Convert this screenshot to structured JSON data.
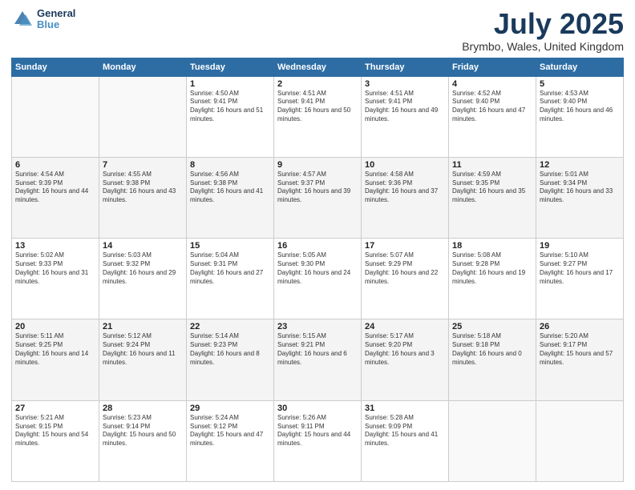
{
  "header": {
    "logo_line1": "General",
    "logo_line2": "Blue",
    "month_title": "July 2025",
    "location": "Brymbo, Wales, United Kingdom"
  },
  "days_of_week": [
    "Sunday",
    "Monday",
    "Tuesday",
    "Wednesday",
    "Thursday",
    "Friday",
    "Saturday"
  ],
  "weeks": [
    [
      {
        "day": "",
        "info": ""
      },
      {
        "day": "",
        "info": ""
      },
      {
        "day": "1",
        "info": "Sunrise: 4:50 AM\nSunset: 9:41 PM\nDaylight: 16 hours and 51 minutes."
      },
      {
        "day": "2",
        "info": "Sunrise: 4:51 AM\nSunset: 9:41 PM\nDaylight: 16 hours and 50 minutes."
      },
      {
        "day": "3",
        "info": "Sunrise: 4:51 AM\nSunset: 9:41 PM\nDaylight: 16 hours and 49 minutes."
      },
      {
        "day": "4",
        "info": "Sunrise: 4:52 AM\nSunset: 9:40 PM\nDaylight: 16 hours and 47 minutes."
      },
      {
        "day": "5",
        "info": "Sunrise: 4:53 AM\nSunset: 9:40 PM\nDaylight: 16 hours and 46 minutes."
      }
    ],
    [
      {
        "day": "6",
        "info": "Sunrise: 4:54 AM\nSunset: 9:39 PM\nDaylight: 16 hours and 44 minutes."
      },
      {
        "day": "7",
        "info": "Sunrise: 4:55 AM\nSunset: 9:38 PM\nDaylight: 16 hours and 43 minutes."
      },
      {
        "day": "8",
        "info": "Sunrise: 4:56 AM\nSunset: 9:38 PM\nDaylight: 16 hours and 41 minutes."
      },
      {
        "day": "9",
        "info": "Sunrise: 4:57 AM\nSunset: 9:37 PM\nDaylight: 16 hours and 39 minutes."
      },
      {
        "day": "10",
        "info": "Sunrise: 4:58 AM\nSunset: 9:36 PM\nDaylight: 16 hours and 37 minutes."
      },
      {
        "day": "11",
        "info": "Sunrise: 4:59 AM\nSunset: 9:35 PM\nDaylight: 16 hours and 35 minutes."
      },
      {
        "day": "12",
        "info": "Sunrise: 5:01 AM\nSunset: 9:34 PM\nDaylight: 16 hours and 33 minutes."
      }
    ],
    [
      {
        "day": "13",
        "info": "Sunrise: 5:02 AM\nSunset: 9:33 PM\nDaylight: 16 hours and 31 minutes."
      },
      {
        "day": "14",
        "info": "Sunrise: 5:03 AM\nSunset: 9:32 PM\nDaylight: 16 hours and 29 minutes."
      },
      {
        "day": "15",
        "info": "Sunrise: 5:04 AM\nSunset: 9:31 PM\nDaylight: 16 hours and 27 minutes."
      },
      {
        "day": "16",
        "info": "Sunrise: 5:05 AM\nSunset: 9:30 PM\nDaylight: 16 hours and 24 minutes."
      },
      {
        "day": "17",
        "info": "Sunrise: 5:07 AM\nSunset: 9:29 PM\nDaylight: 16 hours and 22 minutes."
      },
      {
        "day": "18",
        "info": "Sunrise: 5:08 AM\nSunset: 9:28 PM\nDaylight: 16 hours and 19 minutes."
      },
      {
        "day": "19",
        "info": "Sunrise: 5:10 AM\nSunset: 9:27 PM\nDaylight: 16 hours and 17 minutes."
      }
    ],
    [
      {
        "day": "20",
        "info": "Sunrise: 5:11 AM\nSunset: 9:25 PM\nDaylight: 16 hours and 14 minutes."
      },
      {
        "day": "21",
        "info": "Sunrise: 5:12 AM\nSunset: 9:24 PM\nDaylight: 16 hours and 11 minutes."
      },
      {
        "day": "22",
        "info": "Sunrise: 5:14 AM\nSunset: 9:23 PM\nDaylight: 16 hours and 8 minutes."
      },
      {
        "day": "23",
        "info": "Sunrise: 5:15 AM\nSunset: 9:21 PM\nDaylight: 16 hours and 6 minutes."
      },
      {
        "day": "24",
        "info": "Sunrise: 5:17 AM\nSunset: 9:20 PM\nDaylight: 16 hours and 3 minutes."
      },
      {
        "day": "25",
        "info": "Sunrise: 5:18 AM\nSunset: 9:18 PM\nDaylight: 16 hours and 0 minutes."
      },
      {
        "day": "26",
        "info": "Sunrise: 5:20 AM\nSunset: 9:17 PM\nDaylight: 15 hours and 57 minutes."
      }
    ],
    [
      {
        "day": "27",
        "info": "Sunrise: 5:21 AM\nSunset: 9:15 PM\nDaylight: 15 hours and 54 minutes."
      },
      {
        "day": "28",
        "info": "Sunrise: 5:23 AM\nSunset: 9:14 PM\nDaylight: 15 hours and 50 minutes."
      },
      {
        "day": "29",
        "info": "Sunrise: 5:24 AM\nSunset: 9:12 PM\nDaylight: 15 hours and 47 minutes."
      },
      {
        "day": "30",
        "info": "Sunrise: 5:26 AM\nSunset: 9:11 PM\nDaylight: 15 hours and 44 minutes."
      },
      {
        "day": "31",
        "info": "Sunrise: 5:28 AM\nSunset: 9:09 PM\nDaylight: 15 hours and 41 minutes."
      },
      {
        "day": "",
        "info": ""
      },
      {
        "day": "",
        "info": ""
      }
    ]
  ]
}
